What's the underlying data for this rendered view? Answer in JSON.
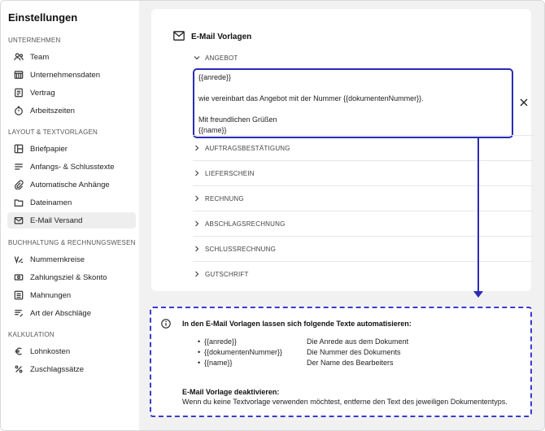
{
  "sidebar": {
    "title": "Einstellungen",
    "sections": [
      {
        "label": "UNTERNEHMEN",
        "items": [
          {
            "label": "Team",
            "icon": "team-icon"
          },
          {
            "label": "Unternehmensdaten",
            "icon": "building-icon"
          },
          {
            "label": "Vertrag",
            "icon": "document-icon"
          },
          {
            "label": "Arbeitszeiten",
            "icon": "stopwatch-icon"
          }
        ]
      },
      {
        "label": "LAYOUT & TEXTVORLAGEN",
        "items": [
          {
            "label": "Briefpapier",
            "icon": "layout-icon"
          },
          {
            "label": "Anfangs- & Schlusstexte",
            "icon": "text-lines-icon"
          },
          {
            "label": "Automatische Anhänge",
            "icon": "paperclip-icon"
          },
          {
            "label": "Dateinamen",
            "icon": "folder-icon"
          },
          {
            "label": "E-Mail Versand",
            "icon": "mail-icon",
            "active": true
          }
        ]
      },
      {
        "label": "BUCHHALTUNG & RECHNUNGSWESEN",
        "items": [
          {
            "label": "Nummernkreise",
            "icon": "numbering-icon"
          },
          {
            "label": "Zahlungsziel & Skonto",
            "icon": "cash-icon"
          },
          {
            "label": "Mahnungen",
            "icon": "list-icon"
          },
          {
            "label": "Art der Abschläge",
            "icon": "list-edit-icon"
          }
        ]
      },
      {
        "label": "KALKULATION",
        "items": [
          {
            "label": "Lohnkosten",
            "icon": "euro-icon"
          },
          {
            "label": "Zuschlagssätze",
            "icon": "percent-icon"
          }
        ]
      }
    ]
  },
  "main": {
    "card_title": "E-Mail Vorlagen",
    "open_section": "ANGEBOT",
    "editor_lines": [
      "{{anrede}}",
      "",
      "wie vereinbart das Angebot mit der Nummer {{dokumentenNummer}}.",
      "",
      "Mit freundlichen Grüßen",
      "{{name}}"
    ],
    "collapsed_sections": [
      "AUFTRAGSBESTÄTIGUNG",
      "LIEFERSCHEIN",
      "RECHNUNG",
      "ABSCHLAGSRECHNUNG",
      "SCHLUSSRECHNUNG",
      "GUTSCHRIFT"
    ]
  },
  "info": {
    "title": "In den E-Mail Vorlagen lassen sich folgende Texte automatisieren:",
    "variables": [
      {
        "name": "{{anrede}}",
        "desc": "Die Anrede aus dem Dokument"
      },
      {
        "name": "{{dokumentenNummer}}",
        "desc": "Die Nummer des Dokuments"
      },
      {
        "name": "{{name}}",
        "desc": "Der Name des Bearbeiters"
      }
    ],
    "subtitle": "E-Mail Vorlage deaktivieren:",
    "description": "Wenn du keine Textvorlage verwenden möchtest, entferne den Text des jeweiligen Dokumententyps."
  },
  "colors": {
    "accent": "#2b2bb5",
    "background": "#f1f1f2"
  }
}
